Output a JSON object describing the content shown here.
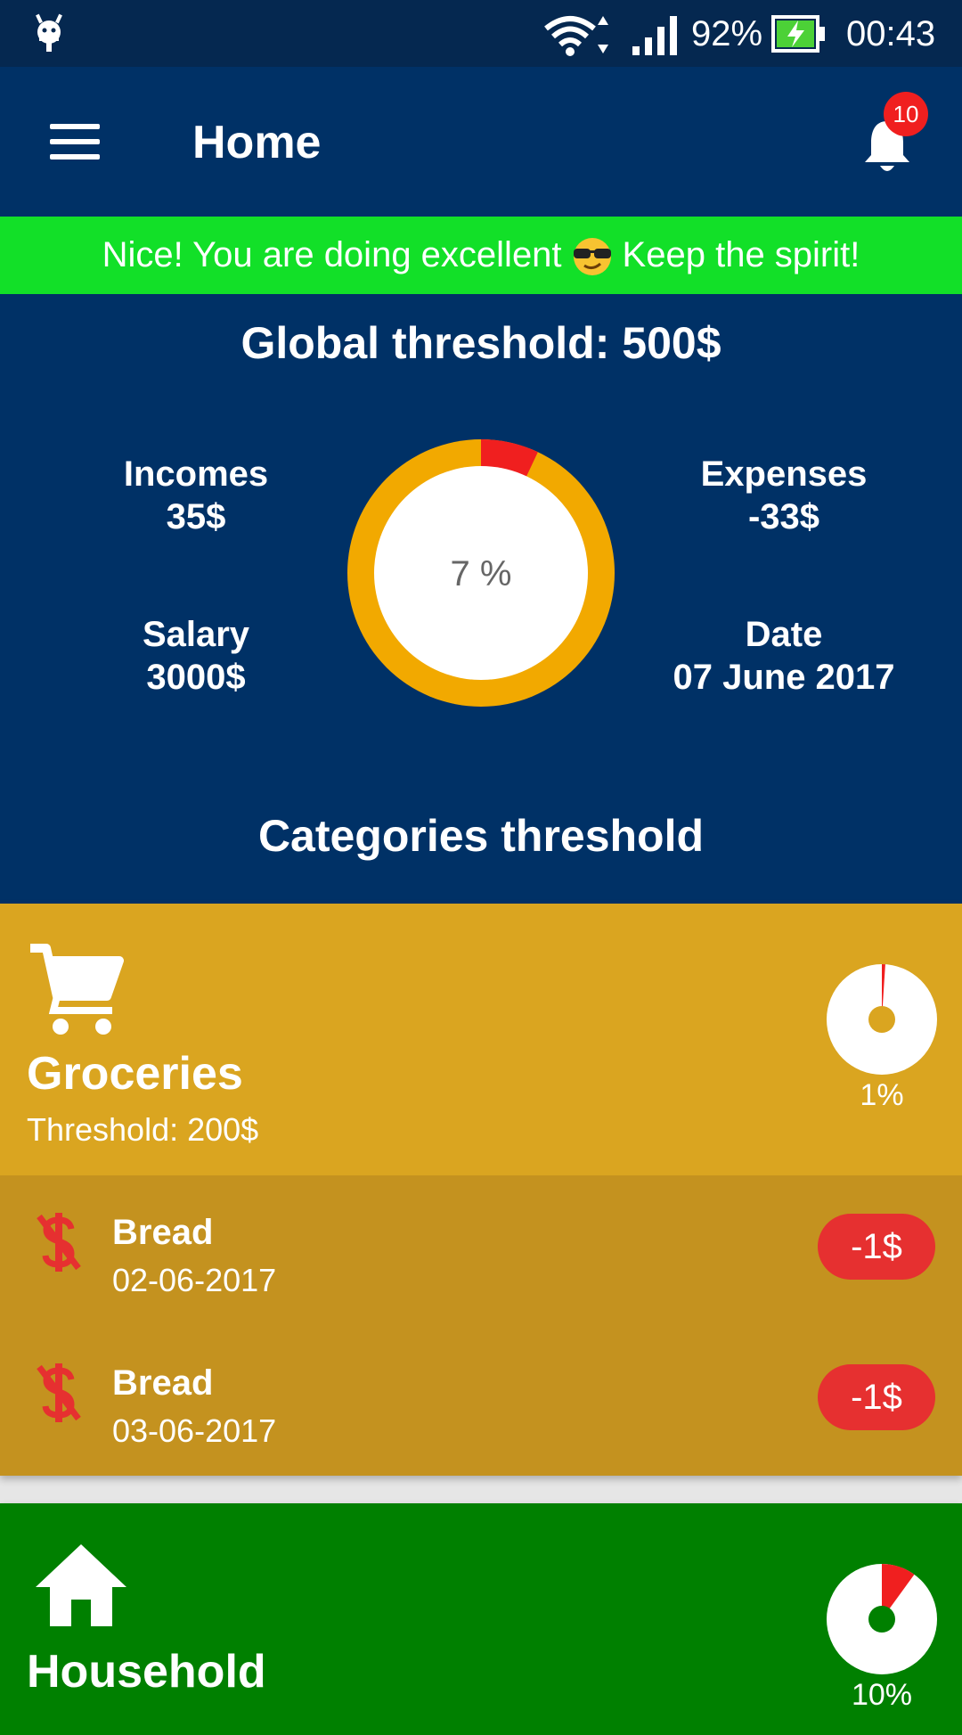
{
  "status_bar": {
    "battery": "92%",
    "time": "00:43"
  },
  "app_bar": {
    "title": "Home",
    "notification_count": "10"
  },
  "banner": {
    "text_before": "Nice! You are doing excellent",
    "text_after": "Keep the spirit!",
    "emoji": "smiling-face-with-sunglasses"
  },
  "summary": {
    "global_threshold": "Global threshold: 500$",
    "incomes_label": "Incomes",
    "incomes_value": "35$",
    "expenses_label": "Expenses",
    "expenses_value": "-33$",
    "salary_label": "Salary",
    "salary_value": "3000$",
    "date_label": "Date",
    "date_value": "07 June 2017",
    "donut_percent": "7 %",
    "donut_fraction": 0.07,
    "categories_heading": "Categories threshold"
  },
  "categories": [
    {
      "name": "Groceries",
      "icon": "cart-icon",
      "threshold": "Threshold: 200$",
      "percent": "1%",
      "fraction": 0.01,
      "color": "#daa520",
      "transactions": [
        {
          "name": "Bread",
          "date": "02-06-2017",
          "amount": "-1$"
        },
        {
          "name": "Bread",
          "date": "03-06-2017",
          "amount": "-1$"
        }
      ]
    },
    {
      "name": "Household",
      "icon": "home-icon",
      "percent": "10%",
      "fraction": 0.1,
      "color": "#008000"
    }
  ],
  "colors": {
    "primary": "#003166",
    "banner": "#12e028",
    "donut_ring": "#f2a900",
    "over_budget": "#f01f1f"
  }
}
